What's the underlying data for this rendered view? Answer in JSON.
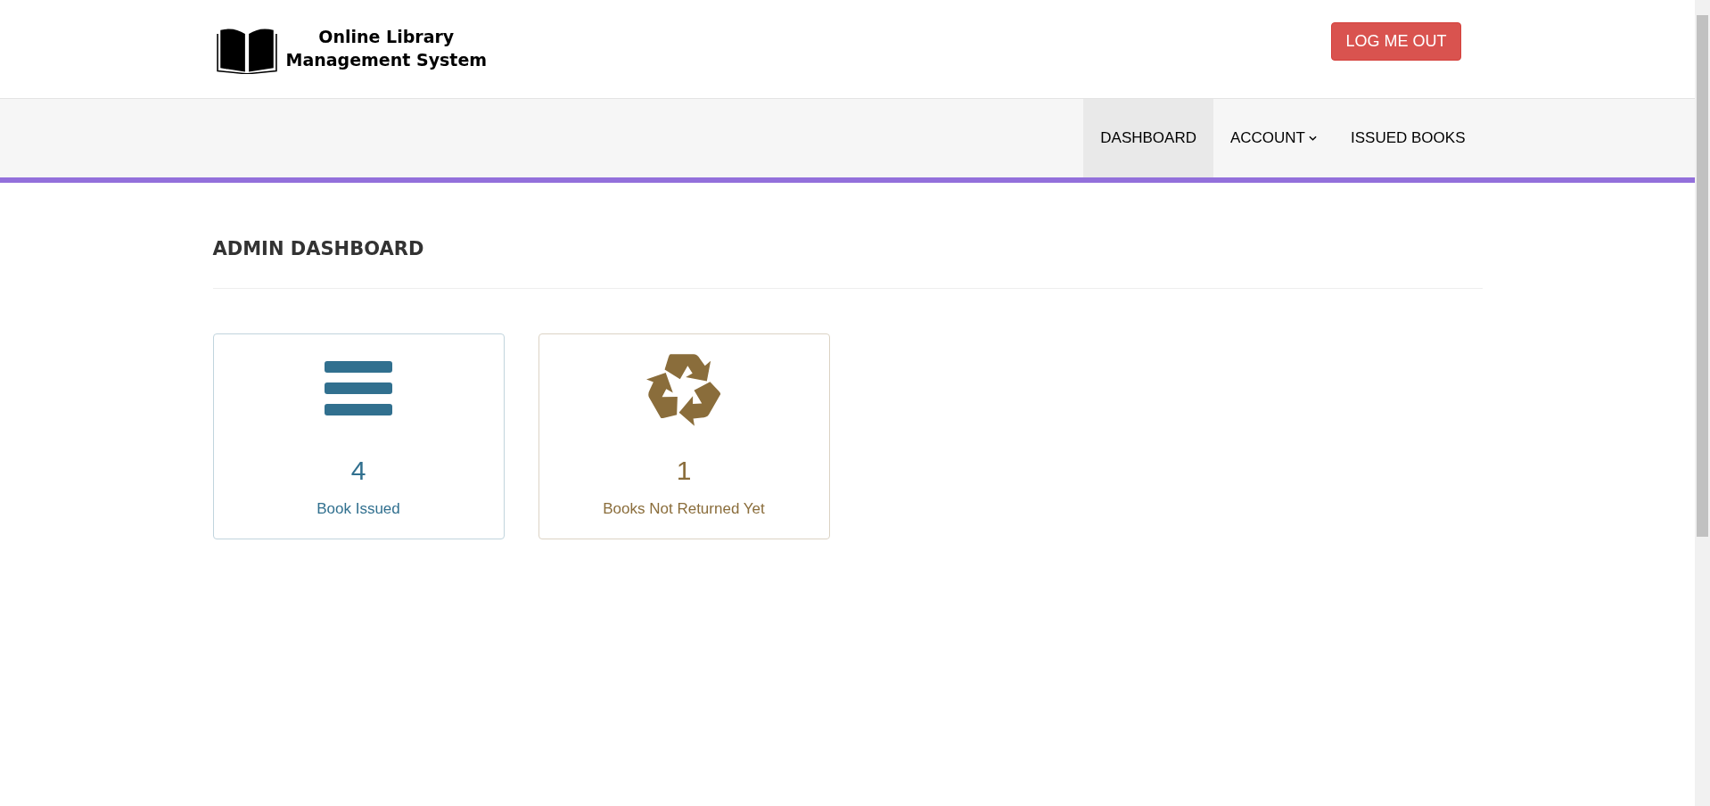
{
  "header": {
    "logo_line_1": "Online Library",
    "logo_line_2": "Management System",
    "logout_button": "LOG ME OUT"
  },
  "nav": [
    {
      "label": "DASHBOARD",
      "selected": true,
      "dropdown": false
    },
    {
      "label": "ACCOUNT",
      "selected": false,
      "dropdown": true
    },
    {
      "label": "ISSUED BOOKS",
      "selected": false,
      "dropdown": false
    }
  ],
  "page_title": "ADMIN DASHBOARD",
  "cards": [
    {
      "kind": "list",
      "count": "4",
      "label": "Book Issued",
      "color": "#31708f"
    },
    {
      "kind": "recycle",
      "count": "1",
      "label": "Books Not Returned Yet",
      "color": "#8a6d3b"
    }
  ]
}
